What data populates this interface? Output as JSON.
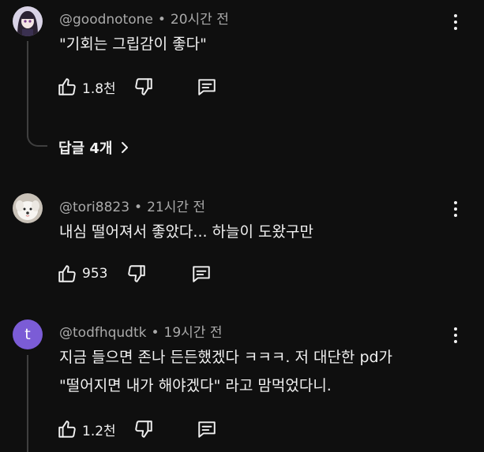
{
  "comments": [
    {
      "handle": "@goodnotone",
      "time": "20시간 전",
      "text_lines": [
        "\"기회는 그립감이 좋다\""
      ],
      "likes": "1.8천",
      "replies_label": "답글 4개",
      "avatar": "anime-character-avatar"
    },
    {
      "handle": "@tori8823",
      "time": "21시간 전",
      "text_lines": [
        "내심 떨어져서 좋았다... 하늘이 도왔구만"
      ],
      "likes": "953",
      "avatar": "white-dog-avatar"
    },
    {
      "handle": "@todfhqudtk",
      "time": "19시간 전",
      "text_lines": [
        "지금 들으면 존나 든든했겠다 ㅋㅋㅋ. 저 대단한 pd가",
        "\"떨어지면 내가 해야겠다\" 라고 맘먹었다니."
      ],
      "likes": "1.2천",
      "avatar_letter": "t",
      "avatar_color": "#7b5cd6"
    }
  ],
  "separator": "•",
  "colors": {
    "background": "#0f0f0f",
    "text": "#f1f1f1",
    "meta": "#aaaaaa",
    "thread_line": "#3f3f3f"
  }
}
